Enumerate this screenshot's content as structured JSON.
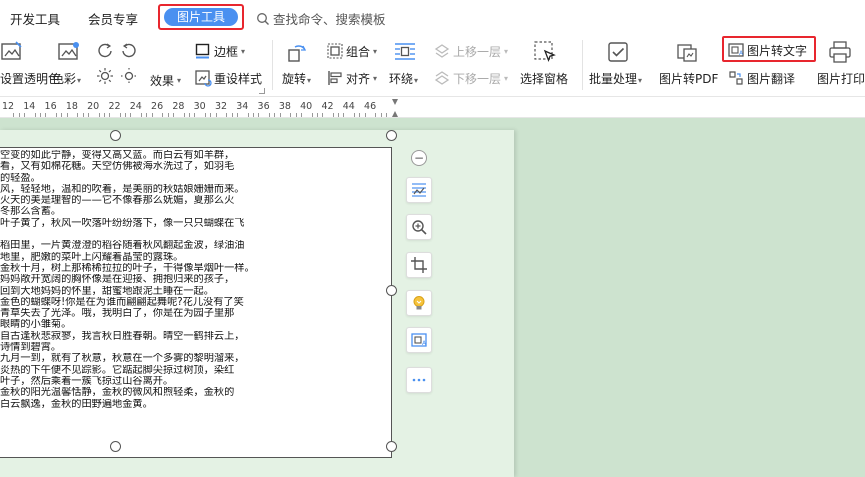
{
  "tabs": {
    "items": [
      "开发工具",
      "会员专享"
    ],
    "active": "图片工具",
    "search_placeholder": "查找命令、搜索模板"
  },
  "ribbon": {
    "set_transparent": "设置透明色",
    "color": "色彩",
    "border": "边框",
    "effects": "效果",
    "reset_style": "重设样式",
    "rotate": "旋转",
    "group": "组合",
    "align": "对齐",
    "wrap": "环绕",
    "bring_forward": "上移一层",
    "send_backward": "下移一层",
    "selection_pane": "选择窗格",
    "batch_process": "批量处理",
    "image_to_pdf": "图片转PDF",
    "image_to_text": "图片转文字",
    "image_translate": "图片翻译",
    "image_print": "图片打印"
  },
  "ruler": {
    "ticks": [
      "12",
      "14",
      "16",
      "18",
      "20",
      "22",
      "24",
      "26",
      "28",
      "30",
      "32",
      "34",
      "36",
      "38",
      "40",
      "42",
      "44",
      "46"
    ]
  },
  "image_text": [
    "空变的如此宁静，变得又高又蓝。而白云有如羊群，",
    "看，又有如棉花糖。天空仿佛被海水洗过了，如羽毛",
    "的轻盈。",
    "风，轻轻地，温和的吹着，是美丽的秋姑娘姗姗而来。",
    "火天的美是理智的——它不像春那么妩媚，夏那么火",
    "冬那么含蓄。",
    "叶子黄了，秋风一吹落叶纷纷落下，像一只只蝴蝶在飞",
    "",
    "稻田里，一片黄澄澄的稻谷随着秋风翻起金波，绿油油",
    "地里，肥嫩的菜叶上闪耀着晶莹的露珠。",
    "金秋十月，树上那稀稀拉拉的叶子，干得像旱烟叶一样。",
    "妈妈敞开宽阔的胸怀像是在迎接、拥抱归来的孩子，",
    "回到大地妈妈的怀里，甜蜜地跟泥土睡在一起。",
    "金色的蝴蝶呀!你是在为谁而翩翩起舞呢?花儿没有了笑",
    "青草失去了光泽。哦，我明白了，你是在为园子里那",
    "眼睛的小雏菊。",
    "自古逢秋悲寂寥，我言秋日胜春朝。晴空一鹤排云上，",
    "诗情到碧霄。",
    "九月一到，就有了秋意，秋意在一个多雾的黎明溜来，",
    "炎热的下午便不见踪影。它踮起脚尖掠过树顶，染红",
    "叶子，然后乘着一簇飞掠过山谷离开。",
    "金秋的阳光温馨恬静，金秋的微风和煦轻柔，金秋的",
    "白云飘逸，金秋的田野遍地金黄。"
  ]
}
